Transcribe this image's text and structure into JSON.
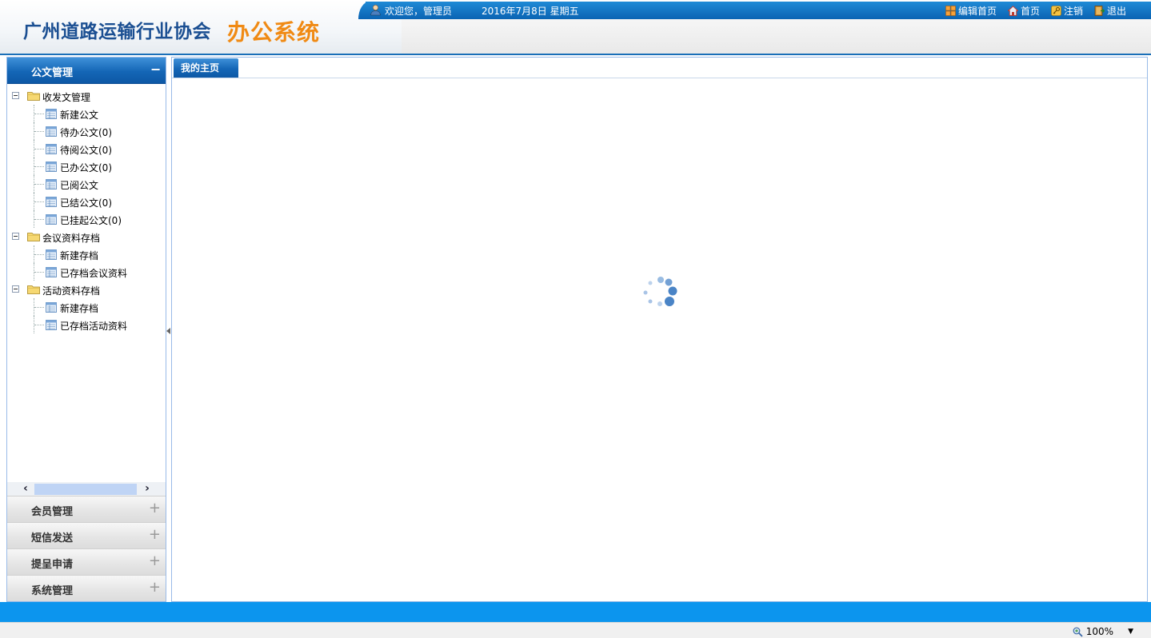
{
  "header": {
    "org_name": "广州道路运输行业协会",
    "system_name": "办公系统",
    "welcome": "欢迎您，管理员",
    "date": "2016年7月8日  星期五",
    "links": [
      {
        "label": "编辑首页",
        "icon": "grid-icon"
      },
      {
        "label": "首页",
        "icon": "home-icon"
      },
      {
        "label": "注销",
        "icon": "key-icon"
      },
      {
        "label": "退出",
        "icon": "exit-door-icon"
      }
    ]
  },
  "sidebar": {
    "active_section": "公文管理",
    "tree": [
      {
        "label": "收发文管理",
        "children": [
          "新建公文",
          "待办公文(0)",
          "待阅公文(0)",
          "已办公文(0)",
          "已阅公文",
          "已结公文(0)",
          "已挂起公文(0)"
        ]
      },
      {
        "label": "会议资料存档",
        "children": [
          "新建存档",
          "已存档会议资料"
        ]
      },
      {
        "label": "活动资料存档",
        "children": [
          "新建存档",
          "已存档活动资料"
        ]
      }
    ],
    "sections": [
      "会员管理",
      "短信发送",
      "提呈申请",
      "系统管理"
    ]
  },
  "main": {
    "active_tab": "我的主页"
  },
  "statusbar": {
    "zoom": "100%"
  },
  "colors": {
    "brand_blue": "#1b4f92",
    "accent_orange": "#f08a14",
    "topbar_blue": "#0a63b3",
    "footer_blue": "#0c95ee"
  }
}
